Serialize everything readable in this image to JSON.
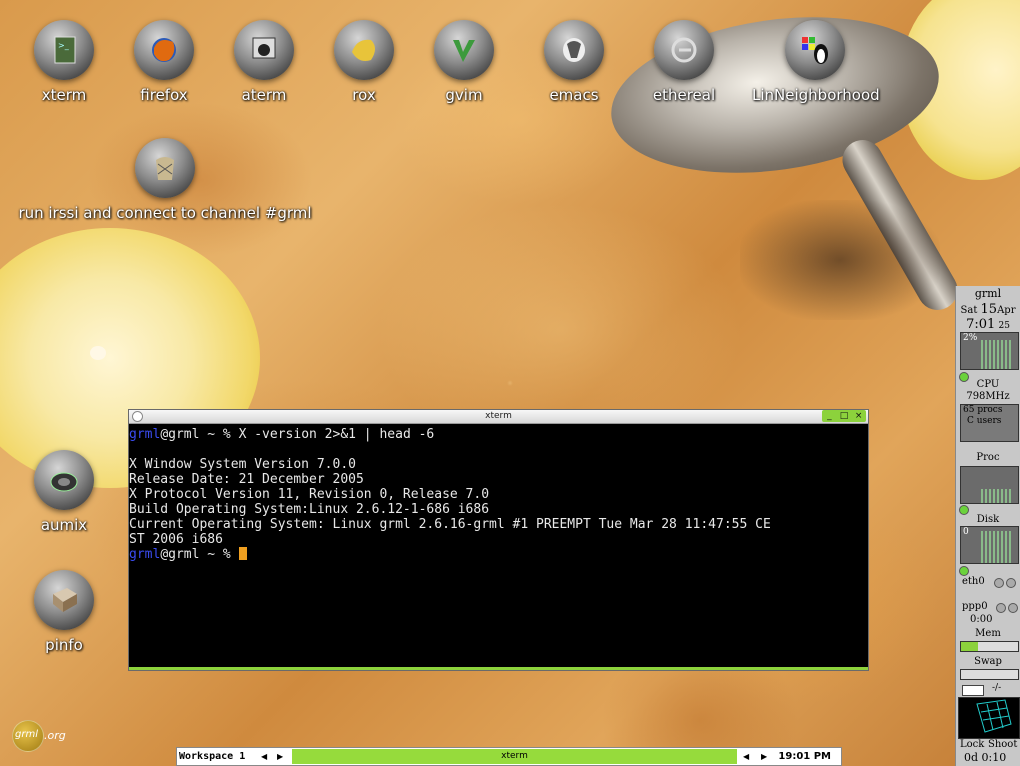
{
  "desktop_icons_row1": [
    {
      "label": "xterm",
      "icon": "terminal-icon"
    },
    {
      "label": "firefox",
      "icon": "firefox-icon"
    },
    {
      "label": "aterm",
      "icon": "aterm-icon"
    },
    {
      "label": "rox",
      "icon": "rox-icon"
    },
    {
      "label": "gvim",
      "icon": "gvim-icon"
    },
    {
      "label": "emacs",
      "icon": "emacs-icon"
    },
    {
      "label": "ethereal",
      "icon": "ethereal-icon"
    },
    {
      "label": "LinNeighborhood",
      "icon": "linneighborhood-icon"
    }
  ],
  "irssi": {
    "label": "run irssi and connect to channel #grml",
    "icon": "irssi-icon"
  },
  "aumix": {
    "label": "aumix",
    "icon": "speaker-icon"
  },
  "pinfo": {
    "label": "pinfo",
    "icon": "book-icon"
  },
  "xterm": {
    "title": "xterm",
    "lines": [
      {
        "user": "grml",
        "rest": "@grml ~ % X -version 2>&1 | head -6"
      },
      {
        "user": "",
        "rest": ""
      },
      {
        "user": "",
        "rest": "X Window System Version 7.0.0"
      },
      {
        "user": "",
        "rest": "Release Date: 21 December 2005"
      },
      {
        "user": "",
        "rest": "X Protocol Version 11, Revision 0, Release 7.0"
      },
      {
        "user": "",
        "rest": "Build Operating System:Linux 2.6.12-1-686 i686"
      },
      {
        "user": "",
        "rest": "Current Operating System: Linux grml 2.6.16-grml #1 PREEMPT Tue Mar 28 11:47:55 CE"
      },
      {
        "user": "",
        "rest": "ST 2006 i686"
      },
      {
        "user": "grml",
        "rest": "@grml ~ % "
      }
    ],
    "buttons": [
      "_",
      "□",
      "×"
    ]
  },
  "taskbar": {
    "workspace": "Workspace 1",
    "task": "xterm",
    "clock": "19:01 PM"
  },
  "logo": {
    "circle": "grml",
    "suffix": ".org"
  },
  "dock": {
    "host": "grml",
    "day": "Sat",
    "date": "15",
    "month": "Apr",
    "time": "7:01",
    "seconds": "25",
    "cpu_percent": "2%",
    "cpu_label": "CPU",
    "cpu_freq": "798MHz",
    "procs": "65 procs",
    "users": "C users",
    "proc_label": "Proc",
    "disk_label": "Disk",
    "disk_value": "0",
    "eth": "eth0",
    "ppp": "ppp0",
    "ppp_time": "0:00",
    "mem": "Mem",
    "swap": "Swap",
    "mail": "-/-",
    "lock": "Lock",
    "shoot": "Shoot",
    "uptime": "0d  0:10"
  }
}
